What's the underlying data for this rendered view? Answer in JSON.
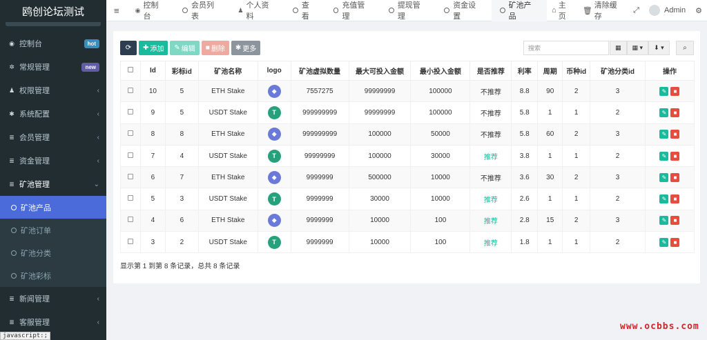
{
  "brand": "鸥创论坛测试",
  "sidebar": {
    "items": [
      {
        "icon": "dashboard-icon",
        "label": "控制台",
        "badge": "hot"
      },
      {
        "icon": "cogs-icon",
        "label": "常规管理",
        "badge": "new"
      },
      {
        "icon": "users-icon",
        "label": "权限管理"
      },
      {
        "icon": "gear-icon",
        "label": "系统配置"
      },
      {
        "icon": "list-icon",
        "label": "会员管理"
      },
      {
        "icon": "list-icon",
        "label": "资金管理"
      },
      {
        "icon": "list-icon",
        "label": "矿池管理"
      }
    ],
    "sub_items": [
      "矿池产品",
      "矿池订单",
      "矿池分类",
      "矿池彩标"
    ],
    "bottom_items": [
      {
        "icon": "list-icon",
        "label": "新闻管理"
      },
      {
        "icon": "list-icon",
        "label": "客服管理"
      }
    ]
  },
  "status_bar": "javascript:;",
  "topbar": {
    "tabs": [
      "控制台",
      "会员列表",
      "个人资料",
      "查看",
      "充值管理",
      "提现管理",
      "资金设置",
      "矿池产品"
    ],
    "home": "主页",
    "clear_cache": "清除缓存",
    "user": "Admin"
  },
  "toolbar": {
    "add": "添加",
    "edit": "编辑",
    "delete": "删除",
    "more": "更多",
    "search_placeholder": "搜索"
  },
  "table": {
    "headers": [
      "Id",
      "彩标id",
      "矿池名称",
      "logo",
      "矿池虚拟数量",
      "最大可投入金额",
      "最小投入金额",
      "是否推荐",
      "利率",
      "周期",
      "币种id",
      "矿池分类id",
      "操作"
    ],
    "rows": [
      {
        "id": "10",
        "tag": "5",
        "name": "ETH Stake",
        "coin": "eth",
        "virtual": "7557275",
        "max": "99999999",
        "min": "100000",
        "recommend": "不推荐",
        "rate": "8.8",
        "period": "90",
        "coin_id": "2",
        "cat": "3"
      },
      {
        "id": "9",
        "tag": "5",
        "name": "USDT Stake",
        "coin": "usdt",
        "virtual": "999999999",
        "max": "99999999",
        "min": "100000",
        "recommend": "不推荐",
        "rate": "5.8",
        "period": "1",
        "coin_id": "1",
        "cat": "2"
      },
      {
        "id": "8",
        "tag": "8",
        "name": "ETH Stake",
        "coin": "eth",
        "virtual": "999999999",
        "max": "100000",
        "min": "50000",
        "recommend": "不推荐",
        "rate": "5.8",
        "period": "60",
        "coin_id": "2",
        "cat": "3"
      },
      {
        "id": "7",
        "tag": "4",
        "name": "USDT Stake",
        "coin": "usdt",
        "virtual": "99999999",
        "max": "100000",
        "min": "30000",
        "recommend": "推荐",
        "rate": "3.8",
        "period": "1",
        "coin_id": "1",
        "cat": "2"
      },
      {
        "id": "6",
        "tag": "7",
        "name": "ETH Stake",
        "coin": "eth",
        "virtual": "9999999",
        "max": "500000",
        "min": "10000",
        "recommend": "不推荐",
        "rate": "3.6",
        "period": "30",
        "coin_id": "2",
        "cat": "3"
      },
      {
        "id": "5",
        "tag": "3",
        "name": "USDT Stake",
        "coin": "usdt",
        "virtual": "9999999",
        "max": "30000",
        "min": "10000",
        "recommend": "推荐",
        "rate": "2.6",
        "period": "1",
        "coin_id": "1",
        "cat": "2"
      },
      {
        "id": "4",
        "tag": "6",
        "name": "ETH Stake",
        "coin": "eth",
        "virtual": "9999999",
        "max": "10000",
        "min": "100",
        "recommend": "推荐",
        "rate": "2.8",
        "period": "15",
        "coin_id": "2",
        "cat": "3"
      },
      {
        "id": "3",
        "tag": "2",
        "name": "USDT Stake",
        "coin": "usdt",
        "virtual": "9999999",
        "max": "10000",
        "min": "100",
        "recommend": "推荐",
        "rate": "1.8",
        "period": "1",
        "coin_id": "1",
        "cat": "2"
      }
    ]
  },
  "pager": "显示第 1 到第 8 条记录，总共 8 条记录",
  "watermark": "www.ocbbs.com"
}
